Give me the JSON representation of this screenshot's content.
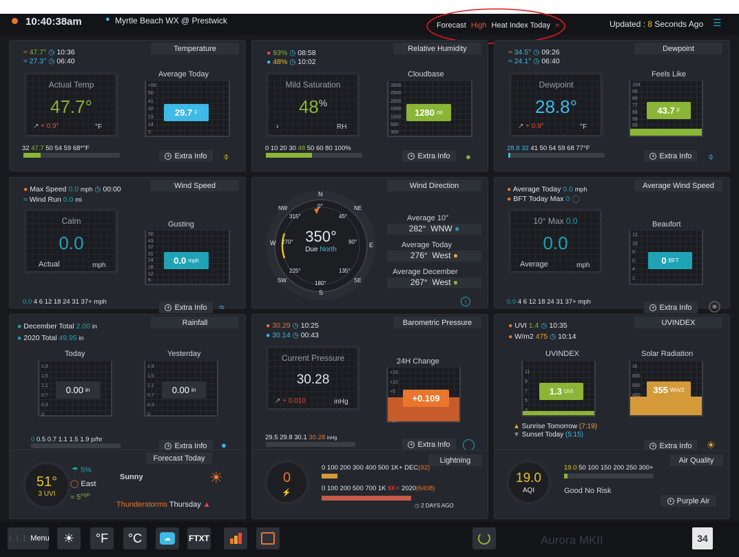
{
  "topbar": {
    "time": "10:40:38am",
    "station": "Myrtle Beach WX @ Prestwick",
    "forecast_prefix": "Forecast",
    "forecast_level": "High",
    "forecast_suffix": "Heat Index  Today",
    "updated_prefix": "Updated :",
    "updated_value": "8",
    "updated_suffix": "Seconds Ago"
  },
  "temperature": {
    "title": "Temperature",
    "max": "47.7°",
    "max_time": "10:36",
    "min": "27.3°",
    "min_time": "06:40",
    "disp_label": "Actual Temp",
    "value": "47.7°",
    "trend": "+ 0.9°",
    "unit": "°F",
    "sub_title": "Average Today",
    "avg": "29.7",
    "avg_unit": "F",
    "scale": [
      "+59",
      "50",
      "41",
      "32",
      "23",
      "14",
      "5"
    ],
    "ticks_pre": "32",
    "ticks_hl": "47.7",
    "ticks_post": "50 54 59 68*°F",
    "extra": "Extra Info",
    "bar_pct": 18
  },
  "humidity": {
    "title": "Relative Humidity",
    "max": "93%",
    "max_time": "08:58",
    "min": "48%",
    "min_time": "10:02",
    "disp_label": "Mild Saturation",
    "value": "48",
    "sup": "%",
    "unit": "RH",
    "sub_title": "Cloudbase",
    "cloudbase": "1280",
    "cloud_unit": "mt",
    "scale": [
      "3000",
      "2500",
      "2000",
      "1500",
      "1000",
      "500",
      "300"
    ],
    "ticks_pre": "0 10 20 30",
    "ticks_hl": "48",
    "ticks_post": "50 60 80 100%",
    "extra": "Extra Info",
    "bar_pct": 48
  },
  "dewpoint": {
    "title": "Dewpoint",
    "max": "34.5°",
    "max_time": "09:26",
    "min": "24.1°",
    "min_time": "06:40",
    "disp_label": "Dewpoint",
    "value": "28.8°",
    "trend": "+ 0.9°",
    "unit": "°F",
    "sub_title": "Feels Like",
    "feels": "43.7",
    "feels_unit": "F",
    "scale": [
      "104",
      "95",
      "86",
      "77",
      "68",
      "59",
      "50",
      "32"
    ],
    "ticks_pre": "28.8",
    "ticks_hl": "32",
    "ticks_post": "41 50 54 59 68 77°F",
    "extra": "Extra Info",
    "bar_pct": 2
  },
  "windspeed": {
    "title": "Wind Speed",
    "max_label": "Max Speed",
    "max": "0.0",
    "max_unit": "mph",
    "max_time": "00:00",
    "run_label": "Wind Run",
    "run": "0.0",
    "run_unit": "mi",
    "disp_label": "Calm",
    "value": "0.0",
    "sub_label": "Actual",
    "unit": "mph",
    "sub_title": "Gusting",
    "gust": "0.0",
    "gust_unit": "mph",
    "scale": [
      "50",
      "43",
      "37",
      "31",
      "24",
      "18",
      "12",
      "6"
    ],
    "ticks_hl": "0.0",
    "ticks_post": "4 6 12 18 24 31 37+  mph",
    "extra": "Extra Info"
  },
  "winddir": {
    "title": "Wind Direction",
    "value": "350°",
    "due": "Due",
    "dir": "North",
    "compass": [
      "N",
      "NE",
      "E",
      "SE",
      "S",
      "SW",
      "W",
      "NW"
    ],
    "degrees": [
      "0°",
      "45°",
      "90°",
      "135°",
      "180°",
      "225°",
      "270°",
      "315°"
    ],
    "avg10_label": "Average 10°",
    "avg10": "282°",
    "avg10_dir": "WNW",
    "avgtoday_label": "Average Today",
    "avgtoday": "276°",
    "avgtoday_dir": "West",
    "avgdec_label": "Average December",
    "avgdec": "267°",
    "avgdec_dir": "West"
  },
  "avgwind": {
    "title": "Average Wind Speed",
    "avg_label": "Average Today",
    "avg": "0.0",
    "avg_unit": "mph",
    "bft_label": "BFT Today Max",
    "bft": "0",
    "disp_label": "10° Max",
    "disp_max": "0.0",
    "value": "0.0",
    "sub_label": "Average",
    "unit": "mph",
    "sub_title": "Beaufort",
    "beaufort": "0",
    "beaufort_unit": "BFT",
    "scale": [
      "12",
      "10",
      "8",
      "6",
      "4",
      "2"
    ],
    "ticks_hl": "0.0",
    "ticks_post": "4 6 12 18 24 31 37+  mph",
    "extra": "Extra Info"
  },
  "rainfall": {
    "title": "Rainfall",
    "dec_label": "December Total",
    "dec": "2.00",
    "dec_unit": "in",
    "year_label": "2020 Total",
    "year": "49.95",
    "year_unit": "in",
    "today_title": "Today",
    "today": "0.00",
    "today_unit": "in",
    "yest_title": "Yesterday",
    "yest": "0.00",
    "yest_unit": "in",
    "scale": [
      "1.9",
      "1.5",
      "1.1",
      "0.7",
      "0.3",
      "0"
    ],
    "ticks_hl": "0",
    "ticks_post": "0.5 0.7 1.1 1.5 1.9 p/hr",
    "extra": "Extra Info"
  },
  "pressure": {
    "title": "Barometric Pressure",
    "max": "30.29",
    "max_time": "10:25",
    "min": "30.14",
    "min_time": "00:43",
    "disp_label": "Current Pressure",
    "value": "30.28",
    "trend": "+ 0.010",
    "unit": "inHg",
    "sub_title": "24H Change",
    "change": "+0.109",
    "scale": [
      "+15",
      "+10",
      "+5",
      "0",
      "-5",
      "-10"
    ],
    "ticks_pre": "29.5 29.8 30.1",
    "ticks_hl": "30.28",
    "ticks_post": "inHg",
    "extra": "Extra Info"
  },
  "uv": {
    "title": "UVINDEX",
    "uvi_label": "UVI",
    "uvi": "1.4",
    "uvi_time": "10:35",
    "wm_label": "W/m2",
    "wm": "475",
    "wm_time": "10:14",
    "uv_title": "UVINDEX",
    "uv_value": "1.3",
    "uv_unit": "UVI",
    "uv_scale": [
      "11",
      "9",
      "7",
      "5",
      "3"
    ],
    "sr_title": "Solar Radiation",
    "sr_value": "355",
    "sr_unit": "Wm/2",
    "sr_scale": [
      "1k",
      "800",
      "600",
      "400",
      "200"
    ],
    "sunrise_label": "Sunrise Tomorrow",
    "sunrise": "(7:19)",
    "sunset_label": "Sunset Today",
    "sunset": "(5:15)",
    "extra": "Extra Info"
  },
  "forecast": {
    "title": "Forecast Today",
    "temp": "51°",
    "uvi": "3 UVI",
    "rain": "5%",
    "wind_dir": "East",
    "wind": "5",
    "wind_unit": "mph",
    "condition": "Sunny",
    "storm": "Thunderstorms",
    "storm_day": "Thursday"
  },
  "lightning": {
    "title": "Lightning",
    "count": "0",
    "row1_ticks": "0 100 200 300 400 500 1K+ DEC",
    "row1_val": "(92)",
    "row2_ticks": "0 100 200 500 700 1K",
    "row2_hl": "6K+",
    "row2_mid": "2020",
    "row2_val": "(6408)",
    "ago": "2 DAYS AGO"
  },
  "aqi": {
    "title": "Air Quality",
    "value": "19.0",
    "unit": "AQI",
    "ticks_hl": "19.0",
    "ticks_post": "50 100 150 200 250 300+",
    "status": "Good No Risk",
    "source": "Purple Air"
  },
  "footer": {
    "menu": "Menu",
    "f": "°F",
    "c": "°C",
    "ftxt": "FTXT",
    "brand": "Aurora MKII",
    "cal": "34"
  },
  "colors": {
    "green": "#8ab536",
    "blue": "#3fb9e6",
    "cyan": "#1fa3b5",
    "orange": "#e8762d",
    "red": "#ee4a3a",
    "yellow": "#e8c326"
  }
}
